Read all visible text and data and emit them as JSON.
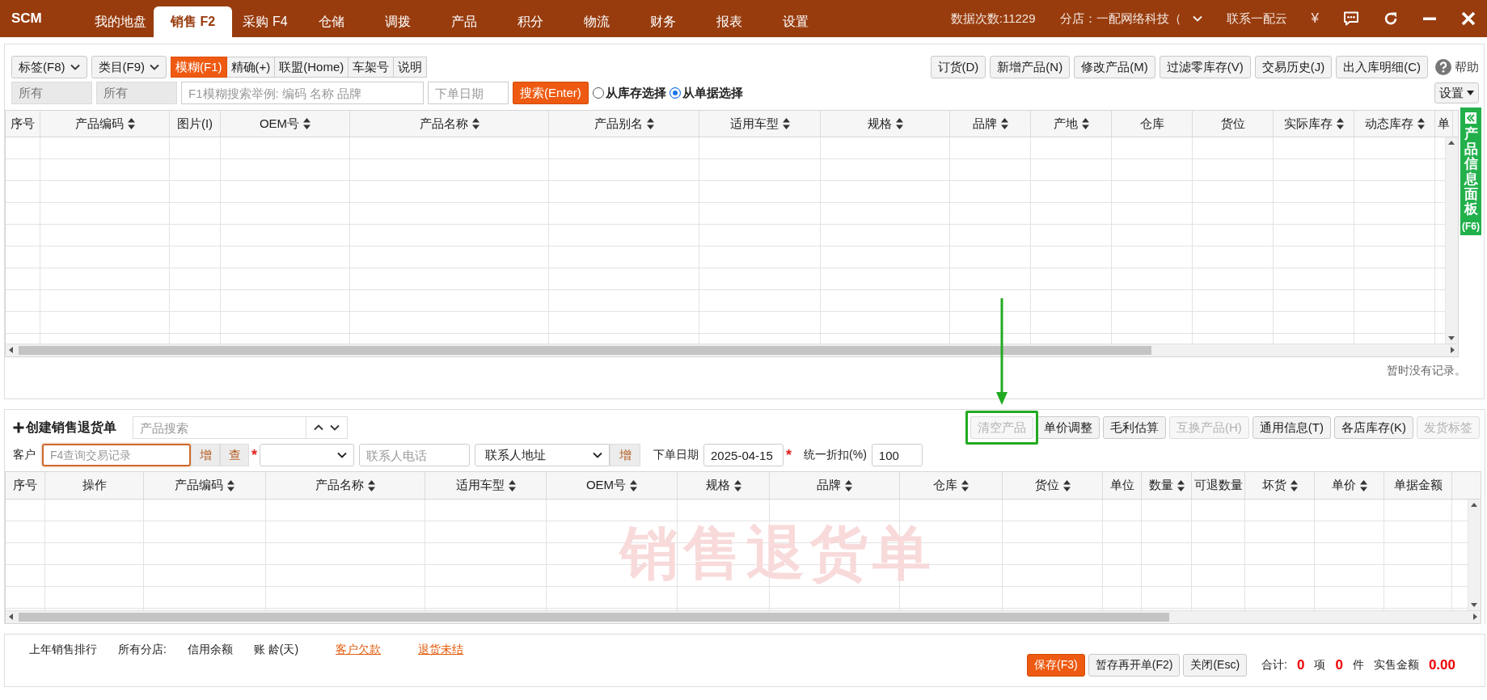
{
  "top_bar": {
    "logo": "SCM",
    "tabs": [
      {
        "label": "我的地盘",
        "selected": false
      },
      {
        "label": "销售 F2",
        "selected": true
      },
      {
        "label": "采购 F4",
        "selected": false
      },
      {
        "label": "仓储",
        "selected": false
      },
      {
        "label": "调拨",
        "selected": false
      },
      {
        "label": "产品",
        "selected": false
      },
      {
        "label": "积分",
        "selected": false
      },
      {
        "label": "物流",
        "selected": false
      },
      {
        "label": "财务",
        "selected": false
      },
      {
        "label": "报表",
        "selected": false
      },
      {
        "label": "设置",
        "selected": false
      }
    ],
    "data_count": "数据次数:11229",
    "branch": "分店：一配网络科技（",
    "contact": "联系一配云",
    "currency": "¥"
  },
  "product_panel": {
    "filters": [
      "标签(F8)",
      "类目(F9)"
    ],
    "modes": [
      {
        "label": "模糊(F1)",
        "selected": true
      },
      {
        "label": "精确(+)",
        "selected": false
      },
      {
        "label": "联盟(Home)",
        "selected": false
      },
      {
        "label": "车架号",
        "selected": false
      },
      {
        "label": "说明",
        "selected": false
      }
    ],
    "actions": [
      "订货(D)",
      "新增产品(N)",
      "修改产品(M)",
      "过滤零库存(V)",
      "交易历史(J)",
      "出入库明细(C)"
    ],
    "help": "帮助",
    "filter_values": [
      "所有",
      "所有"
    ],
    "search_field": {
      "placeholder": "F1模糊搜索举例: 编码 名称 品牌"
    },
    "date_field": {
      "placeholder": "下单日期"
    },
    "search_button": "搜索(Enter)",
    "sources": [
      {
        "label": "从库存选择",
        "selected": false
      },
      {
        "label": "从单据选择",
        "selected": true
      }
    ],
    "settings": "设置",
    "columns": [
      {
        "label": "序号",
        "sortable": false
      },
      {
        "label": "产品编码",
        "sortable": true
      },
      {
        "label": "图片(I)",
        "sortable": false
      },
      {
        "label": "OEM号",
        "sortable": true
      },
      {
        "label": "产品名称",
        "sortable": true
      },
      {
        "label": "产品别名",
        "sortable": true
      },
      {
        "label": "适用车型",
        "sortable": true
      },
      {
        "label": "规格",
        "sortable": true
      },
      {
        "label": "品牌",
        "sortable": true
      },
      {
        "label": "产地",
        "sortable": true
      },
      {
        "label": "仓库",
        "sortable": false
      },
      {
        "label": "货位",
        "sortable": false
      },
      {
        "label": "实际库存",
        "sortable": true
      },
      {
        "label": "动态库存",
        "sortable": true
      },
      {
        "label": "单",
        "sortable": false
      }
    ],
    "empty_message": "暂时没有记录。"
  },
  "side_panel": {
    "title": "产品信息面板",
    "shortcut": "(F6)"
  },
  "return_order": {
    "title": "创建销售退货单",
    "product_search": {
      "placeholder": "产品搜索"
    },
    "actions": [
      {
        "label": "清空产品",
        "disabled": true,
        "highlighted": true
      },
      {
        "label": "单价调整",
        "disabled": false,
        "highlighted": false
      },
      {
        "label": "毛利估算",
        "disabled": false,
        "highlighted": false
      },
      {
        "label": "互换产品(H)",
        "disabled": true,
        "highlighted": false
      },
      {
        "label": "通用信息(T)",
        "disabled": false,
        "highlighted": false
      },
      {
        "label": "各店库存(K)",
        "disabled": false,
        "highlighted": false
      },
      {
        "label": "发货标签",
        "disabled": true,
        "highlighted": false
      }
    ],
    "customer": {
      "label": "客户",
      "placeholder": "F4查询交易记录",
      "focused": true,
      "add": "增",
      "lookup": "查",
      "required_mark": "*"
    },
    "phone": {
      "placeholder": "联系人电话"
    },
    "address": {
      "value": "联系人地址",
      "add": "增"
    },
    "order_date": {
      "label": "下单日期",
      "value": "2025-04-15",
      "required_mark": "*"
    },
    "discount": {
      "label": "统一折扣(%)",
      "value": "100"
    },
    "columns": [
      {
        "label": "序号",
        "sortable": false
      },
      {
        "label": "操作",
        "sortable": false
      },
      {
        "label": "产品编码",
        "sortable": true
      },
      {
        "label": "产品名称",
        "sortable": true
      },
      {
        "label": "适用车型",
        "sortable": true
      },
      {
        "label": "OEM号",
        "sortable": true
      },
      {
        "label": "规格",
        "sortable": true
      },
      {
        "label": "品牌",
        "sortable": true
      },
      {
        "label": "仓库",
        "sortable": true
      },
      {
        "label": "货位",
        "sortable": true
      },
      {
        "label": "单位",
        "sortable": false
      },
      {
        "label": "数量",
        "sortable": true
      },
      {
        "label": "可退数量",
        "sortable": false
      },
      {
        "label": "坏货",
        "sortable": true
      },
      {
        "label": "单价",
        "sortable": true
      },
      {
        "label": "单据金额",
        "sortable": false
      }
    ],
    "watermark": "销售退货单"
  },
  "footer": {
    "stats": [
      "上年销售排行",
      "所有分店:",
      "信用余额",
      "账 龄(天)"
    ],
    "links": [
      "客户欠款",
      "退货未结"
    ],
    "buttons": [
      {
        "label": "保存(F3)",
        "primary": true
      },
      {
        "label": "暂存再开单(F2)",
        "primary": false
      },
      {
        "label": "关闭(Esc)",
        "primary": false
      }
    ],
    "totals": [
      {
        "kind": "label",
        "text": "合计:"
      },
      {
        "kind": "value",
        "text": "0"
      },
      {
        "kind": "label",
        "text": "项"
      },
      {
        "kind": "value",
        "text": "0"
      },
      {
        "kind": "label",
        "text": "件"
      },
      {
        "kind": "label",
        "text": "实售金额"
      },
      {
        "kind": "value",
        "text": "0.00"
      }
    ]
  }
}
